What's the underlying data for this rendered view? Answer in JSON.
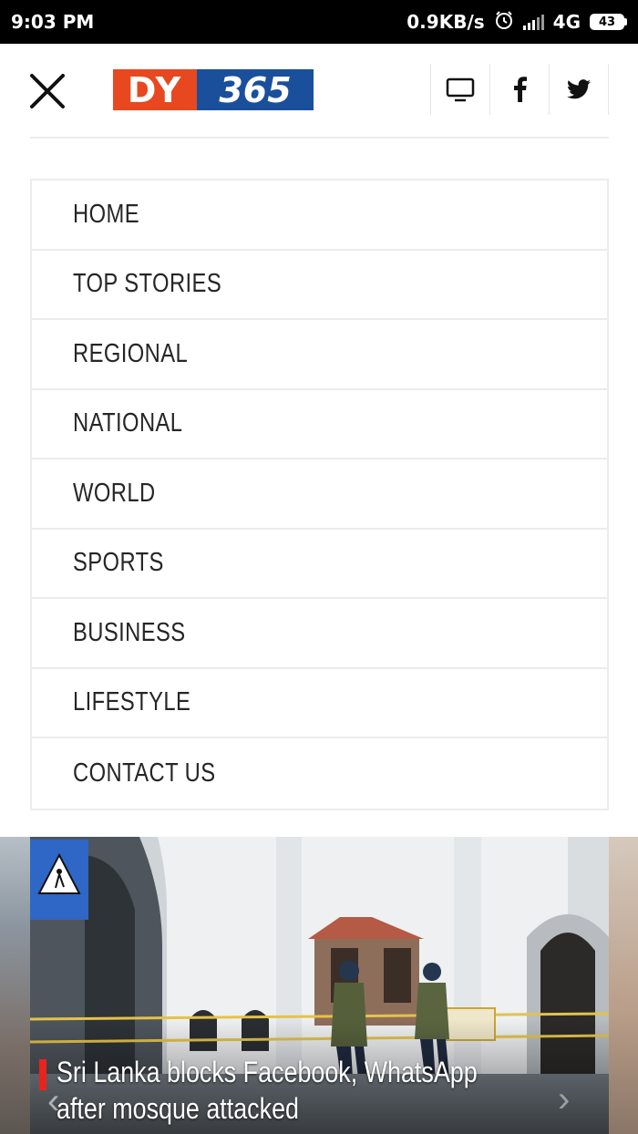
{
  "status_bar": {
    "time": "9:03 PM",
    "network_speed": "0.9KB/s",
    "network_type": "4G",
    "battery": "43",
    "icons": [
      "alarm-icon",
      "signal-icon",
      "battery-icon"
    ]
  },
  "header": {
    "logo_left": "DY",
    "logo_right": "365",
    "icons": [
      "close-icon",
      "tv-icon",
      "facebook-icon",
      "twitter-icon"
    ],
    "colors": {
      "logo_orange": "#e8481f",
      "logo_blue": "#1a4f9c"
    }
  },
  "menu": {
    "items": [
      {
        "label": "HOME"
      },
      {
        "label": "TOP STORIES"
      },
      {
        "label": "REGIONAL"
      },
      {
        "label": "NATIONAL"
      },
      {
        "label": "WORLD"
      },
      {
        "label": "SPORTS"
      },
      {
        "label": "BUSINESS"
      },
      {
        "label": "LIFESTYLE"
      },
      {
        "label": "CONTACT US"
      }
    ]
  },
  "slider": {
    "caption_line1": "Sri Lanka blocks Facebook, WhatsApp",
    "caption_line2": "after mosque attacked",
    "accent_color": "#e8251c"
  }
}
